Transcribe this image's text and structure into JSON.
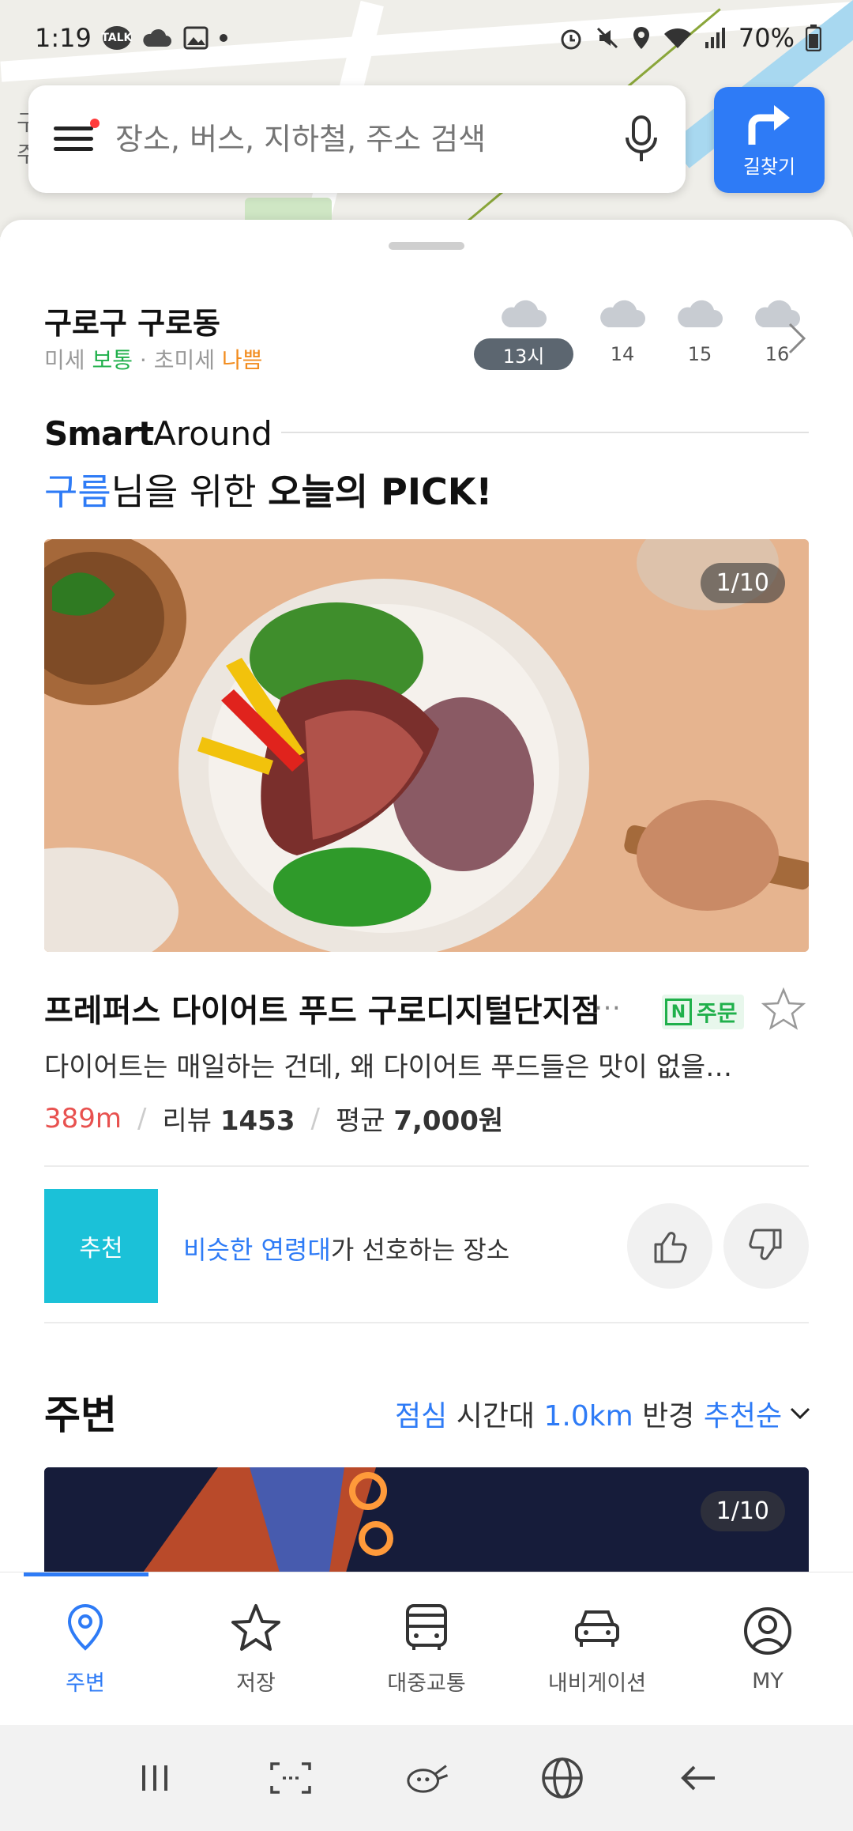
{
  "status_bar": {
    "time": "1:19",
    "talk_label": "TALK",
    "battery": "70%"
  },
  "search": {
    "placeholder": "장소, 버스, 지하철, 주소 검색",
    "directions_label": "길찾기"
  },
  "weather": {
    "location": "구로구 구로동",
    "fine_dust_label": "미세",
    "fine_dust_value": "보통",
    "ultra_fine_dust_label": "초미세",
    "ultra_fine_dust_value": "나쁨",
    "hours": [
      "13시",
      "14",
      "15",
      "16"
    ]
  },
  "smart_around": {
    "logo_bold": "Smart",
    "logo_light": "Around",
    "pick_name": "구름",
    "pick_mid": "님을 위한 ",
    "pick_bold": "오늘의 PICK!",
    "photo_counter": "1/10",
    "place_title": "프레퍼스 다이어트 푸드 구로디지털단지점",
    "more": "…",
    "order_n": "N",
    "order_label": "주문",
    "description": "다이어트는 매일하는 건데, 왜 다이어트 푸드들은 맛이 없을…",
    "distance": "389m",
    "review_label": "리뷰",
    "review_count": "1453",
    "price_label": "평균",
    "price_value": "7,000원",
    "recommend_badge": "추천",
    "recommend_highlight": "비슷한 연령대",
    "recommend_rest": "가 선호하는 장소"
  },
  "nearby": {
    "title": "주변",
    "filter_time": "점심",
    "filter_time_suffix": " 시간대 ",
    "filter_radius": "1.0km",
    "filter_radius_suffix": " 반경 ",
    "filter_sort": "추천순",
    "photo_counter": "1/10"
  },
  "bottom_nav": {
    "items": [
      {
        "label": "주변",
        "icon": "location-pin-icon",
        "active": true
      },
      {
        "label": "저장",
        "icon": "star-icon",
        "active": false
      },
      {
        "label": "대중교통",
        "icon": "bus-icon",
        "active": false
      },
      {
        "label": "내비게이션",
        "icon": "car-icon",
        "active": false
      },
      {
        "label": "MY",
        "icon": "profile-icon",
        "active": false
      }
    ]
  },
  "map_labels": [
    "구",
    "주"
  ],
  "colors": {
    "accent": "#2e7bf6",
    "recommend": "#1bc1d8",
    "distance": "#e8514f",
    "good": "#20b04b",
    "bad": "#f28c1e"
  }
}
